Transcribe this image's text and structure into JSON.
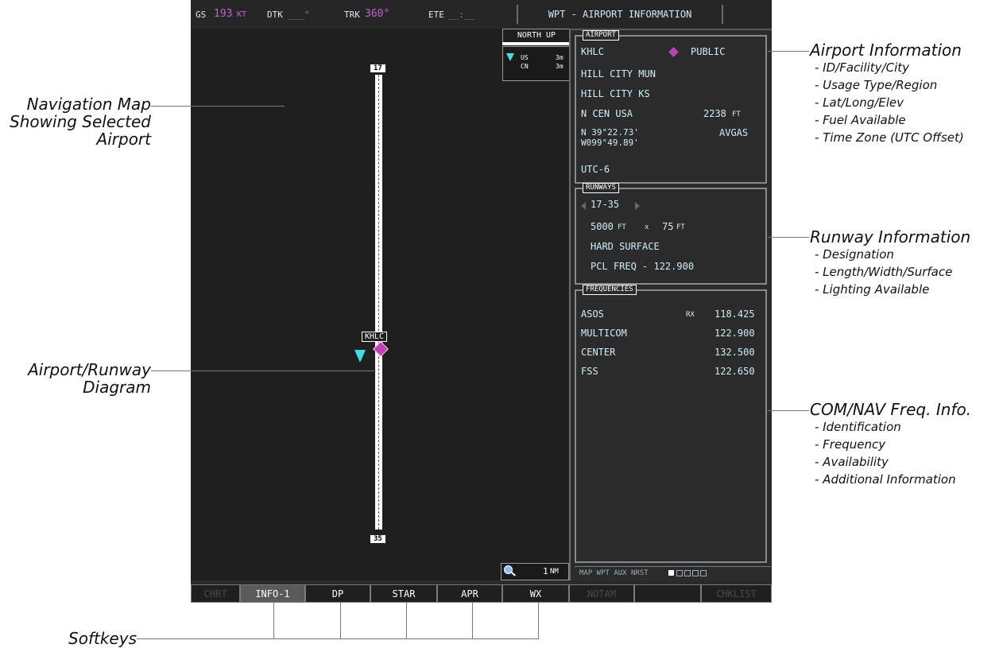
{
  "topbar": {
    "gs_label": "GS",
    "gs_value": "193",
    "gs_unit": "KT",
    "dtk_label": "DTK",
    "dtk_value": "___°",
    "trk_label": "TRK",
    "trk_value": "360°",
    "ete_label": "ETE",
    "ete_value": "__:__",
    "page_title": "WPT - AIRPORT INFORMATION"
  },
  "map": {
    "orientation": "NORTH UP",
    "legend": [
      {
        "label": "US",
        "value": "3m"
      },
      {
        "label": "CN",
        "value": "3m"
      }
    ],
    "runway_top_label": "17",
    "runway_bottom_label": "35",
    "airport_label": "KHLC",
    "range": "1",
    "range_unit": "NM"
  },
  "airport_panel": {
    "title": "AIRPORT",
    "id": "KHLC",
    "usage": "PUBLIC",
    "facility": "HILL CITY MUN",
    "city": "HILL CITY KS",
    "region": "N CEN USA",
    "elevation": "2238",
    "elevation_unit": "FT",
    "lat": "N 39°22.73'",
    "long": "W099°49.89'",
    "fuel": "AVGAS",
    "time_zone": "UTC-6"
  },
  "runways_panel": {
    "title": "RUNWAYS",
    "designation": "17-35",
    "length": "5000",
    "length_unit": "FT",
    "x": "x",
    "width": "75",
    "width_unit": "FT",
    "surface": "HARD SURFACE",
    "lighting": "PCL FREQ - 122.900"
  },
  "freq_panel": {
    "title": "FREQUENCIES",
    "rows": [
      {
        "name": "ASOS",
        "flag": "RX",
        "freq": "118.425"
      },
      {
        "name": "MULTICOM",
        "flag": "",
        "freq": "122.900"
      },
      {
        "name": "CENTER",
        "flag": "",
        "freq": "132.500"
      },
      {
        "name": "FSS",
        "flag": "",
        "freq": "122.650"
      }
    ]
  },
  "page_group": {
    "text": "MAP WPT AUX NRST"
  },
  "softkeys": [
    "CHRT",
    "INFO-1",
    "DP",
    "STAR",
    "APR",
    "WX",
    "NOTAM",
    "",
    "CHKLIST"
  ],
  "callouts": {
    "nav_map": [
      "Navigation Map",
      "Showing Selected",
      "Airport"
    ],
    "diagram": [
      "Airport/Runway",
      "Diagram"
    ],
    "softkeys": "Softkeys",
    "airport_info": {
      "title": "Airport Information",
      "items": [
        "- ID/Facility/City",
        "- Usage Type/Region",
        "- Lat/Long/Elev",
        "- Fuel Available",
        "- Time Zone (UTC Offset)"
      ]
    },
    "runway_info": {
      "title": "Runway Information",
      "items": [
        "- Designation",
        "- Length/Width/Surface",
        "- Lighting Available"
      ]
    },
    "comnav_info": {
      "title": "COM/NAV Freq. Info.",
      "items": [
        "- Identification",
        "- Frequency",
        "- Availability",
        "- Additional Information"
      ]
    }
  }
}
